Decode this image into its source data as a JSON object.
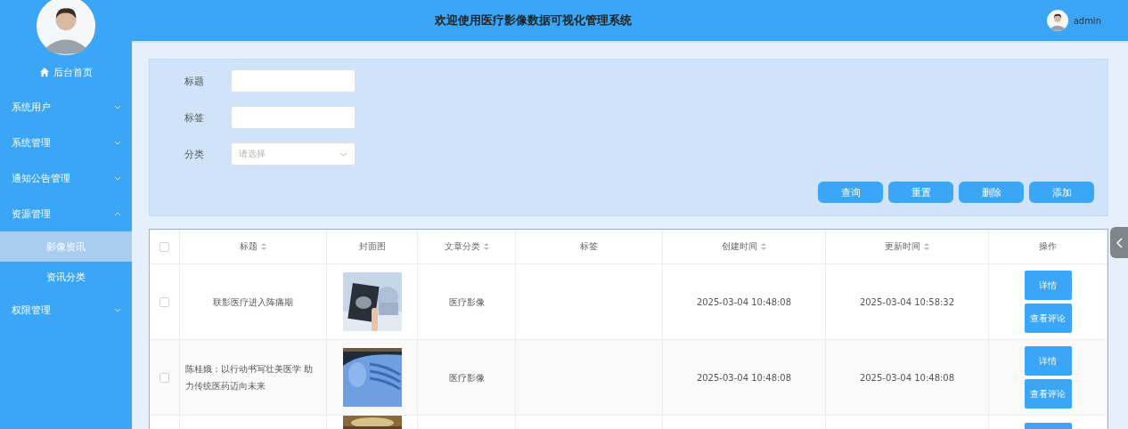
{
  "sidebar": {
    "home": {
      "label": "后台首页"
    },
    "menu": [
      {
        "label": "系统用户",
        "expanded": false
      },
      {
        "label": "系统管理",
        "expanded": false
      },
      {
        "label": "通知公告管理",
        "expanded": false
      },
      {
        "label": "资源管理",
        "expanded": true,
        "children": [
          {
            "label": "影像资讯",
            "selected": true
          },
          {
            "label": "资讯分类",
            "selected": false
          }
        ]
      },
      {
        "label": "权限管理",
        "expanded": false
      }
    ]
  },
  "header": {
    "title": "欢迎使用医疗影像数据可视化管理系统",
    "user": "admin"
  },
  "search": {
    "fields": [
      {
        "label": "标题",
        "kind": "text"
      },
      {
        "label": "标签",
        "kind": "text"
      },
      {
        "label": "分类",
        "kind": "select",
        "placeholder": "请选择"
      }
    ],
    "buttons": [
      "查询",
      "重置",
      "删除",
      "添加"
    ]
  },
  "table": {
    "select_all": {
      "checked": false
    },
    "columns": [
      {
        "label": "标题",
        "sortable": true
      },
      {
        "label": "封面图",
        "sortable": false
      },
      {
        "label": "文章分类",
        "sortable": true
      },
      {
        "label": "标签",
        "sortable": false
      },
      {
        "label": "创建时间",
        "sortable": true
      },
      {
        "label": "更新时间",
        "sortable": true
      },
      {
        "label": "操作",
        "sortable": false
      }
    ],
    "rows": [
      {
        "kind": "full",
        "checked": false,
        "title": "联影医疗进入阵痛期",
        "category": "医疗影像",
        "created": "2025-03-04 10:48:08",
        "updated": "2025-03-04 10:58:32",
        "actions": [
          "详情",
          "查看评论"
        ]
      },
      {
        "kind": "full",
        "checked": false,
        "title": "陈桂娥：以行动书写壮美医学 助力传统医药迈向未来",
        "category": "医疗影像",
        "created": "2025-03-04 10:48:08",
        "updated": "2025-03-04 10:48:08",
        "actions": [
          "详情",
          "查看评论"
        ]
      },
      {
        "kind": "partial"
      }
    ]
  }
}
